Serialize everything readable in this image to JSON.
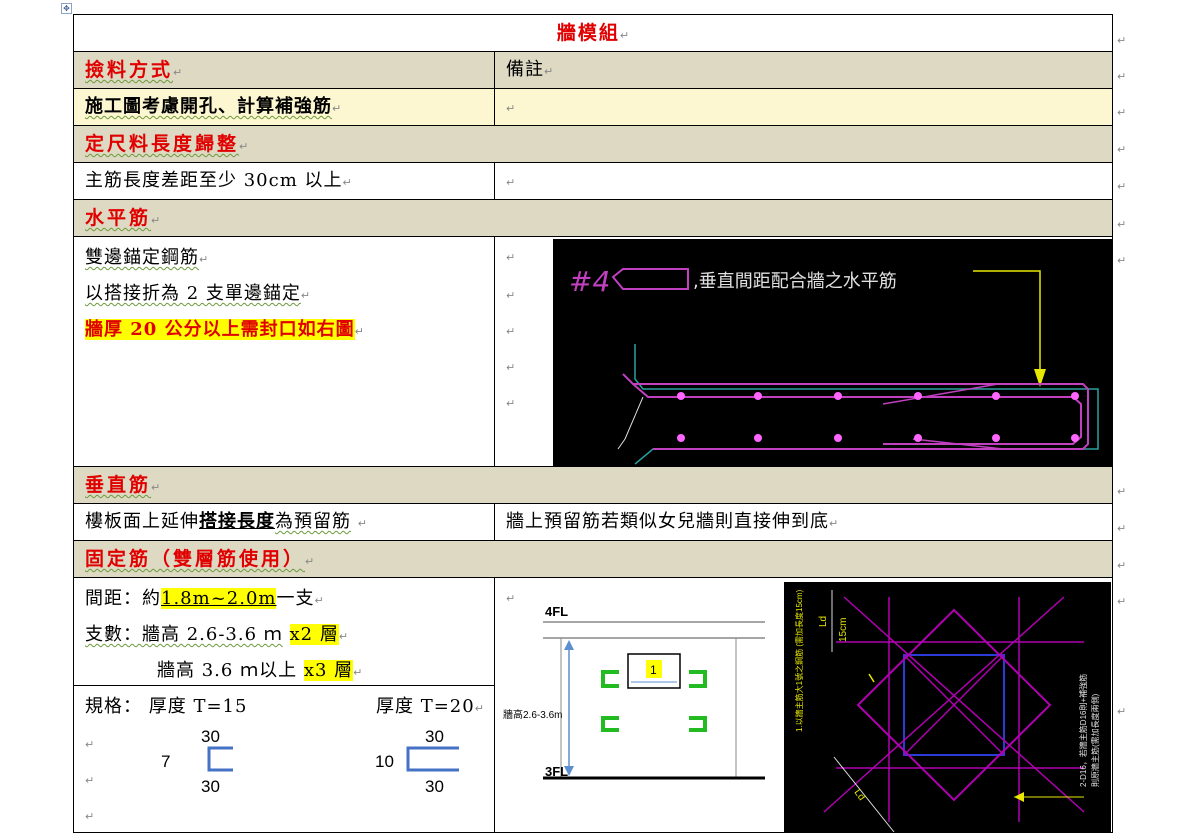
{
  "title": "牆模組",
  "header_left": "撿料方式",
  "header_right": "備註",
  "row_openings": "施工圖考慮開孔、計算補強筋",
  "section_cut": "定尺料長度歸整",
  "row_cut_text": "主筋長度差距至少 30cm 以上",
  "section_horizontal": "水平筋",
  "horizontal_lines": [
    "雙邊錨定鋼筋",
    "以搭接折為 2 支單邊錨定",
    "牆厚 20 公分以上需封口如右圖"
  ],
  "cad1": {
    "label_no": "#4",
    "label_text": ",垂直間距配合牆之水平筋"
  },
  "section_vertical": "垂直筋",
  "vertical_left_parts": [
    "樓板面上延伸",
    "搭接長度",
    "為預留筋"
  ],
  "vertical_right": "牆上預留筋若類似女兒牆則直接伸到底",
  "section_fixing": "固定筋（雙層筋使用）",
  "fixing": {
    "spacing_prefix": "間距：約",
    "spacing_value": "1.8m~2.0m",
    "spacing_suffix": "一支",
    "count_prefix": "支數：牆高 2.6-3.6 ｍ",
    "count_value1": "x2 層",
    "count_line2": "牆高 3.6 ｍ以上",
    "count_value2": "x3 層"
  },
  "spec": {
    "label": "規格：",
    "t15": "厚度 T=15",
    "t20": "厚度 T=20",
    "dim_top": "30",
    "dim_bottom": "30",
    "dim_left_15": "7",
    "dim_left_20": "10"
  },
  "diagram2": {
    "top_floor": "4FL",
    "bottom_floor": "3FL",
    "height_label": "牆高2.6-3.6m",
    "marker": "1"
  },
  "cad2": {
    "ld_top": "Ld",
    "cover": "15cm",
    "side_text": "1.以牆主筋大1號之鋼筋 (需加長度15cm)",
    "right_text1": "2-D16，若牆主筋D16則+補強筋",
    "right_text2": "則原牆主筋(需加長度兩側)",
    "ld_bottom": "Ld"
  },
  "colors": {
    "red": "#e00000",
    "gray": "#ddd9c3",
    "yellow": "#ffff00",
    "cad_magenta": "#b000b0",
    "cad_blue": "#2b3bd8",
    "cad_yellow": "#e8e800"
  }
}
